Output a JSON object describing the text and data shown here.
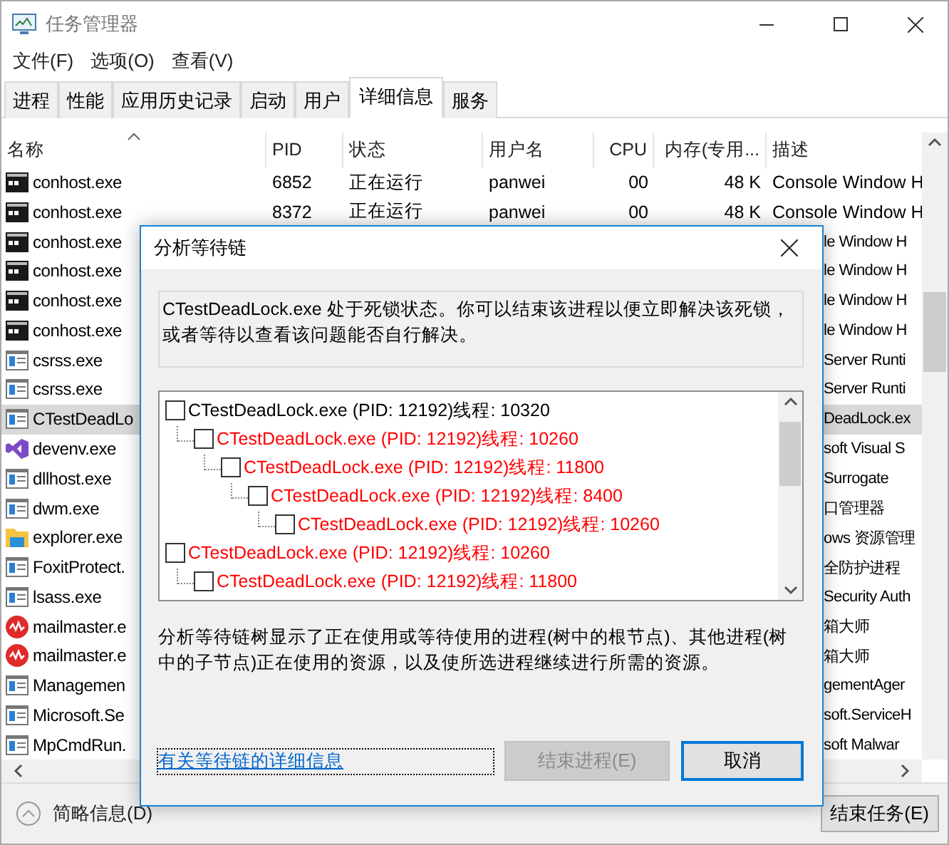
{
  "window": {
    "title": "任务管理器"
  },
  "menu": [
    "文件(F)",
    "选项(O)",
    "查看(V)"
  ],
  "tabs": [
    {
      "label": "进程",
      "selected": false
    },
    {
      "label": "性能",
      "selected": false
    },
    {
      "label": "应用历史记录",
      "selected": false
    },
    {
      "label": "启动",
      "selected": false
    },
    {
      "label": "用户",
      "selected": false
    },
    {
      "label": "详细信息",
      "selected": true
    },
    {
      "label": "服务",
      "selected": false
    }
  ],
  "columns": [
    {
      "label": "名称",
      "sorted": true
    },
    {
      "label": "PID",
      "sorted": false
    },
    {
      "label": "状态",
      "sorted": false
    },
    {
      "label": "用户名",
      "sorted": false
    },
    {
      "label": "CPU",
      "sorted": false
    },
    {
      "label": "内存(专用...",
      "sorted": false
    },
    {
      "label": "描述",
      "sorted": false
    }
  ],
  "rows": [
    {
      "kind": "console",
      "name": "conhost.exe",
      "pid": "6852",
      "status": "正在运行",
      "user": "panwei",
      "cpu": "00",
      "memory": "48 K",
      "description": "Console Window H",
      "selected": false
    },
    {
      "kind": "console",
      "name": "conhost.exe",
      "pid": "8372",
      "status": "正在运行",
      "user": "panwei",
      "cpu": "00",
      "memory": "48 K",
      "description": "Console Window H",
      "selected": false
    },
    {
      "kind": "console",
      "name": "conhost.exe",
      "description": "le Window H",
      "selected": false
    },
    {
      "kind": "console",
      "name": "conhost.exe",
      "description": "le Window H",
      "selected": false
    },
    {
      "kind": "console",
      "name": "conhost.exe",
      "description": "le Window H",
      "selected": false
    },
    {
      "kind": "console",
      "name": "conhost.exe",
      "description": "le Window H",
      "selected": false
    },
    {
      "kind": "app",
      "name": "csrss.exe",
      "description": "Server Runti",
      "selected": false
    },
    {
      "kind": "app",
      "name": "csrss.exe",
      "description": "Server Runti",
      "selected": false
    },
    {
      "kind": "app",
      "name": "CTestDeadLo",
      "description": "DeadLock.ex",
      "selected": true
    },
    {
      "kind": "vs",
      "name": "devenv.exe",
      "description": "soft Visual S",
      "selected": false
    },
    {
      "kind": "app",
      "name": "dllhost.exe",
      "description": "Surrogate",
      "selected": false
    },
    {
      "kind": "app",
      "name": "dwm.exe",
      "description": "口管理器",
      "selected": false
    },
    {
      "kind": "folder",
      "name": "explorer.exe",
      "description": "ows 资源管理",
      "selected": false
    },
    {
      "kind": "app",
      "name": "FoxitProtect.",
      "description": "全防护进程",
      "selected": false
    },
    {
      "kind": "app",
      "name": "lsass.exe",
      "description": "Security Auth",
      "selected": false
    },
    {
      "kind": "mail",
      "name": "mailmaster.e",
      "description": "箱大师",
      "selected": false
    },
    {
      "kind": "mail",
      "name": "mailmaster.e",
      "description": "箱大师",
      "selected": false
    },
    {
      "kind": "app",
      "name": "Managemen",
      "description": "gementAger",
      "selected": false
    },
    {
      "kind": "app",
      "name": "Microsoft.Se",
      "description": "soft.ServiceH",
      "selected": false
    },
    {
      "kind": "app",
      "name": "MpCmdRun.",
      "description": "soft Malwar",
      "selected": false
    }
  ],
  "status_bar": {
    "details": "简略信息(D)",
    "end_task": "结束任务(E)"
  },
  "dialog": {
    "title": "分析等待链",
    "message": "CTestDeadLock.exe 处于死锁状态。你可以结束该进程以便立即解决该死锁，或者等待以查看该问题能否自行解决。",
    "tree": [
      {
        "label": "CTestDeadLock.exe (PID: 12192)线程: 10320",
        "color": "#000000",
        "checked": false,
        "children": [
          {
            "label": "CTestDeadLock.exe (PID: 12192)线程: 10260",
            "color": "#ff0000",
            "checked": false,
            "children": [
              {
                "label": "CTestDeadLock.exe (PID: 12192)线程: 11800",
                "color": "#ff0000",
                "checked": false,
                "children": [
                  {
                    "label": "CTestDeadLock.exe (PID: 12192)线程: 8400",
                    "color": "#ff0000",
                    "checked": false,
                    "children": [
                      {
                        "label": "CTestDeadLock.exe (PID: 12192)线程: 10260",
                        "color": "#ff0000",
                        "checked": false
                      }
                    ]
                  }
                ]
              }
            ]
          }
        ]
      },
      {
        "label": "CTestDeadLock.exe (PID: 12192)线程: 10260",
        "color": "#ff0000",
        "checked": false,
        "children": [
          {
            "label": "CTestDeadLock.exe (PID: 12192)线程: 11800",
            "color": "#ff0000",
            "checked": false
          }
        ]
      }
    ],
    "explanation": "分析等待链树显示了正在使用或等待使用的进程(树中的根节点)、其他进程(树中的子节点)正在使用的资源，以及使所选进程继续进行所需的资源。",
    "link": "有关等待链的详细信息",
    "buttons": [
      {
        "label": "结束进程(E)",
        "disabled": true,
        "default": false
      },
      {
        "label": "取消",
        "disabled": false,
        "default": true
      }
    ]
  }
}
